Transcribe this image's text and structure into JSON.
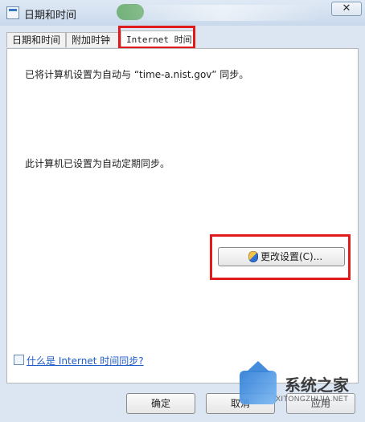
{
  "window": {
    "title": "日期和时间",
    "close_label": "✕"
  },
  "tabs": [
    {
      "label": "日期和时间"
    },
    {
      "label": "附加时钟"
    },
    {
      "label": "Internet 时间"
    }
  ],
  "panel": {
    "sync_text": "已将计算机设置为自动与 “time-a.nist.gov” 同步。",
    "auto_text": "此计算机已设置为自动定期同步。",
    "change_settings_label": "更改设置(C)...",
    "help_link": "什么是 Internet 时间同步?"
  },
  "buttons": {
    "ok": "确定",
    "cancel": "取消",
    "apply": "应用"
  },
  "watermark": {
    "text": "系统之家",
    "url": "XITONGZHIJIA.NET"
  },
  "colors": {
    "highlight": "#e11b1b",
    "link": "#1d5cc8"
  },
  "icons": {
    "window": "clock-icon",
    "close": "close-icon",
    "uac": "uac-shield-icon",
    "help": "help-icon",
    "watermark": "house-logo-icon"
  }
}
